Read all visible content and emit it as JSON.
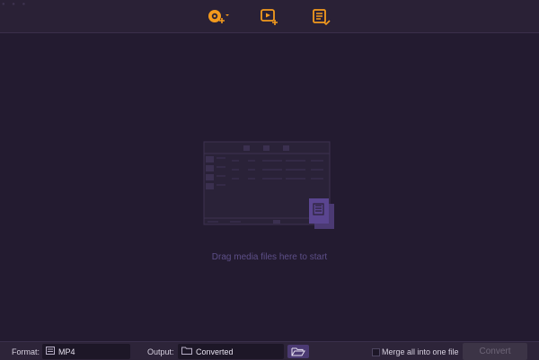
{
  "toolbar": {
    "items": [
      {
        "icon": "add-dvd-icon"
      },
      {
        "icon": "add-video-icon"
      },
      {
        "icon": "task-list-icon"
      }
    ],
    "accent": "#f39a1d"
  },
  "main": {
    "hint": "Drag media files here to start",
    "illustration_icon": "media-files-illustration"
  },
  "bottom": {
    "format_label": "Format:",
    "format_value": "MP4",
    "output_label": "Output:",
    "output_value": "Converted",
    "merge_label": "Merge all into one file",
    "merge_checked": false,
    "convert_label": "Convert"
  },
  "colors": {
    "background": "#231b30",
    "bar": "#2d2439",
    "browse_button": "#4b3a73",
    "hint_text": "#5d4f88"
  }
}
